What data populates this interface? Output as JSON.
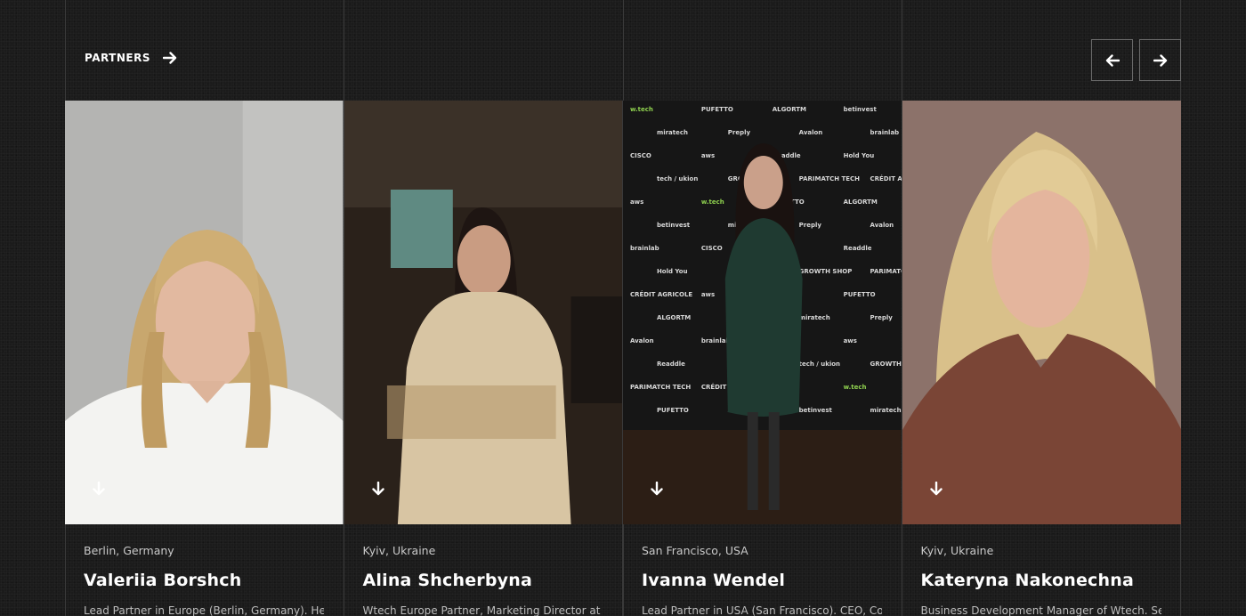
{
  "section": {
    "label": "PARTNERS"
  },
  "nav": {
    "prev_icon": "arrow-left-icon",
    "next_icon": "arrow-right-icon"
  },
  "partners": [
    {
      "location": "Berlin, Germany",
      "name": "Valeriia Borshch",
      "bio": "Lead Partner in Europe (Berlin, Germany). Head of",
      "photo_bg": "#b9b9b7",
      "hair": "#c8a76e",
      "clothing": "#f3f3f1"
    },
    {
      "location": "Kyiv, Ukraine",
      "name": "Alina Shcherbyna",
      "bio": "Wtech Europe Partner, Marketing Director at Five",
      "photo_bg": "#2c231c",
      "hair": "#1e1512",
      "clothing": "#d8c5a3"
    },
    {
      "location": "San Francisco, USA",
      "name": "Ivanna Wendel",
      "bio": "Lead Partner in USA (San Francisco). CEO, Co-",
      "photo_bg": "#1d1d1d",
      "hair": "#1a1210",
      "clothing": "#1f3a31",
      "backdrop_logos": [
        "w.tech",
        "PUFETTO",
        "ALGORTM",
        "betinvest",
        "miratech",
        "Preply",
        "Avalon",
        "brainlab",
        "CISCO",
        "aws",
        "Readdle",
        "Hold You",
        "tech / ukion",
        "GROWTH SHOP",
        "PARIMATCH TECH",
        "CRÉDIT AGRICOLE",
        "aws"
      ]
    },
    {
      "location": "Kyiv, Ukraine",
      "name": "Kateryna Nakonechna",
      "bio": "Business Development Manager of Wtech. Senior",
      "photo_bg": "#8a6f67",
      "hair": "#d9c08a",
      "clothing": "#7a4536"
    }
  ]
}
